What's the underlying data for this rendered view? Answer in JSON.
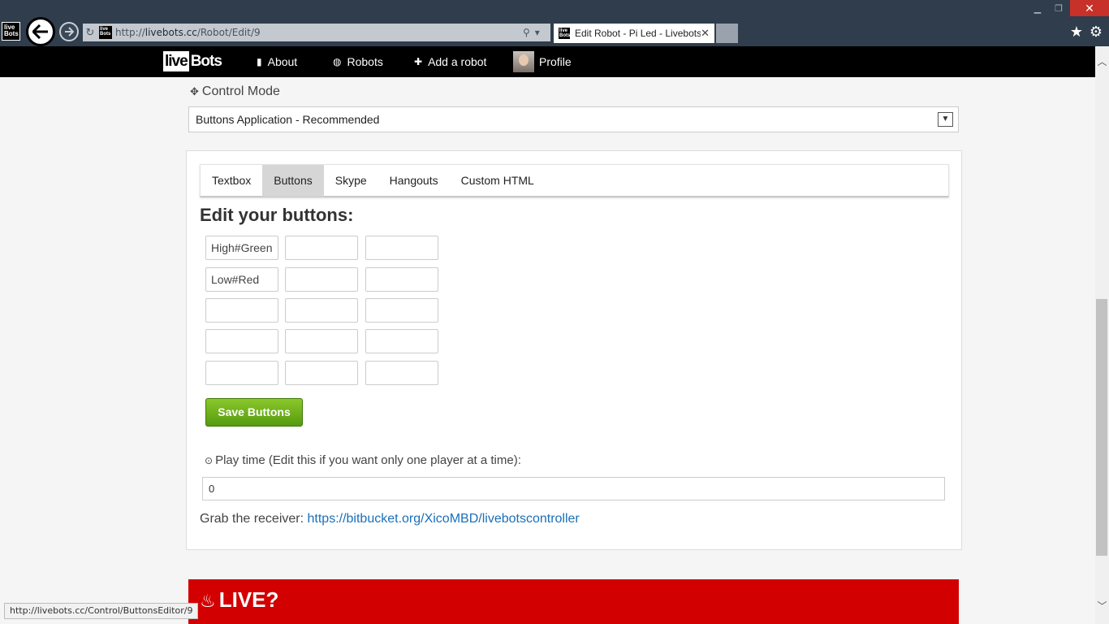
{
  "browser": {
    "url_prefix": "http://",
    "url_host": "livebots.cc",
    "url_path": "/Robot/Edit/9",
    "tab_title": "Edit Robot - Pi Led - Livebots",
    "tab_close": "✕",
    "status_url": "http://livebots.cc/Control/ButtonsEditor/9"
  },
  "nav": {
    "logo_part1": "live",
    "logo_part2": "Bots",
    "about": "About",
    "robots": "Robots",
    "add_robot": "Add a robot",
    "profile": "Profile"
  },
  "control_mode": {
    "label": "Control Mode",
    "selected": "Buttons Application - Recommended"
  },
  "tabs": [
    "Textbox",
    "Buttons",
    "Skype",
    "Hangouts",
    "Custom HTML"
  ],
  "active_tab": "Buttons",
  "editor": {
    "title": "Edit your buttons:",
    "grid": [
      [
        "High#Green",
        "",
        ""
      ],
      [
        "Low#Red",
        "",
        ""
      ],
      [
        "",
        "",
        ""
      ],
      [
        "",
        "",
        ""
      ],
      [
        "",
        "",
        ""
      ]
    ],
    "save_label": "Save Buttons"
  },
  "playtime": {
    "label": "Play time (Edit this if you want only one player at a time):",
    "value": "0"
  },
  "receiver": {
    "prefix": "Grab the receiver: ",
    "link": "https://bitbucket.org/XicoMBD/livebotscontroller"
  },
  "live": {
    "label": "LIVE?"
  },
  "colors": {
    "navbar": "#000000",
    "save_button": "#6aaf1c",
    "live_banner": "#d20000",
    "link": "#1a6fb8"
  }
}
